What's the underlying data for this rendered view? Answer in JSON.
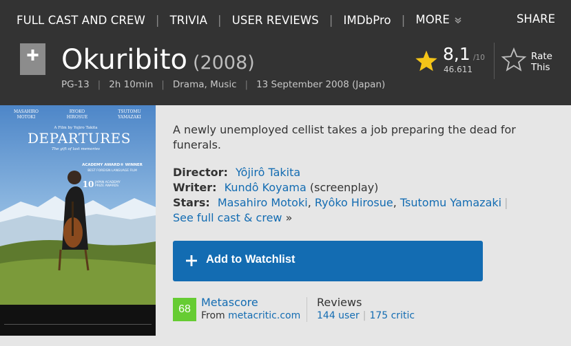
{
  "nav": {
    "items": [
      "FULL CAST AND CREW",
      "TRIVIA",
      "USER REVIEWS",
      "IMDbPro",
      "MORE"
    ],
    "share": "SHARE"
  },
  "title": {
    "name": "Okuribito",
    "year": "(2008)"
  },
  "subline": {
    "rating": "PG-13",
    "runtime": "2h 10min",
    "genres": "Drama, Music",
    "release": "13 September 2008 (Japan)"
  },
  "rating": {
    "score": "8,1",
    "out_of": "/10",
    "votes": "46.611",
    "star_color": "#f5c518"
  },
  "rate": {
    "line1": "Rate",
    "line2": "This"
  },
  "poster": {
    "actor1_first": "MASAHIRO",
    "actor1_last": "MOTOKI",
    "actor2_first": "RYOKO",
    "actor2_last": "HIROSUE",
    "actor3_first": "TSUTOMU",
    "actor3_last": "YAMAZAKI",
    "film_by": "A Film by Yojiro Takita",
    "title": "DEPARTURES",
    "tagline": "The gift of last memories",
    "award_line1": "ACADEMY AWARD® WINNER",
    "award_line2": "BEST FOREIGN LANGUAGE FILM",
    "prize_number": "10",
    "prize_text1": "JAPAN ACADEMY",
    "prize_text2": "PRIZE AWARDS"
  },
  "plot": "A newly unemployed cellist takes a job preparing the dead for funerals.",
  "credits": {
    "director_label": "Director:",
    "director": "Yôjirô Takita",
    "writer_label": "Writer:",
    "writer": "Kundô Koyama",
    "writer_note": "(screenplay)",
    "stars_label": "Stars:",
    "stars": [
      "Masahiro Motoki",
      "Ryôko Hirosue",
      "Tsutomu Yamazaki"
    ],
    "see_full": "See full cast & crew",
    "see_full_arrow": "»"
  },
  "watchlist": {
    "label": "Add to Watchlist",
    "color": "#136cb2"
  },
  "metascore": {
    "score": "68",
    "label": "Metascore",
    "from": "From",
    "source": "metacritic.com",
    "color": "#66cc33"
  },
  "reviews": {
    "label": "Reviews",
    "user": "144 user",
    "critic": "175 critic"
  }
}
